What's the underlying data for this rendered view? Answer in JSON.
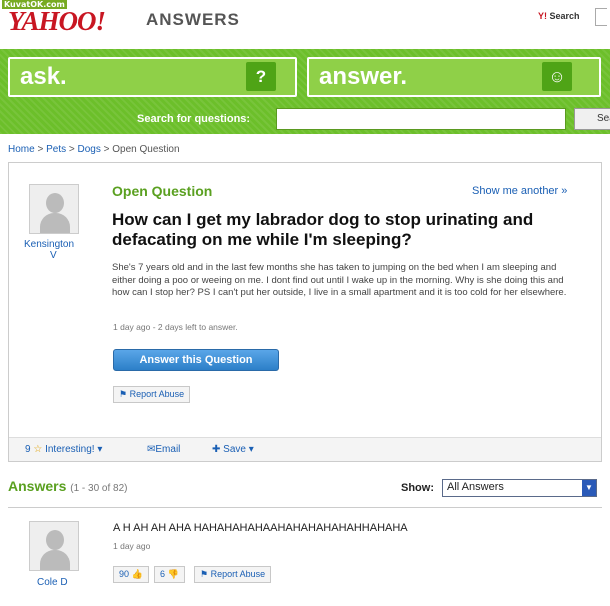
{
  "watermark": "KuvatOK.com",
  "brand": {
    "logo": "YAHOO!",
    "section": "ANSWERS"
  },
  "header": {
    "search_link": "Search"
  },
  "ask": {
    "label": "ask.",
    "icon_glyph": "?"
  },
  "answer": {
    "label": "answer.",
    "icon_glyph": "☺"
  },
  "search": {
    "label": "Search for questions:",
    "value": "",
    "button": "Search"
  },
  "breadcrumb": [
    "Home",
    "Pets",
    "Dogs",
    "Open Question"
  ],
  "question": {
    "status": "Open Question",
    "show_another": "Show me another »",
    "asker": "Kensington",
    "title": "How can I get my labrador dog to stop urinating and defacating on me while I'm sleeping?",
    "body": "She's 7 years old and in the last few months she has taken to jumping on the bed when I am sleeping and either doing a poo or weeing on me. I dont find out until I wake up in the morning. Why is she doing this and how can I stop her? PS I can't put her outside, I live in a small apartment and it is too cold for her elsewhere.",
    "meta": "1 day ago - 2 days left to answer.",
    "answer_button": "Answer this Question",
    "report_abuse": "Report Abuse"
  },
  "toolbar": {
    "interesting_count": "9",
    "interesting": "Interesting!",
    "email": "Email",
    "save": "Save"
  },
  "answers": {
    "heading": "Answers",
    "range": "(1 - 30 of 82)",
    "show_label": "Show:",
    "show_value": "All Answers"
  },
  "answer_item": {
    "user": "Cole D",
    "text": "A H AH AH AHA HAHAHAHAHAAHAHAHAHAHAHHAHAHA",
    "meta": "1 day ago",
    "thumbs_up": "90",
    "thumbs_down": "6",
    "report_abuse": "Report Abuse"
  },
  "colors": {
    "brand_red": "#c81622",
    "green": "#6cbf2a",
    "link_blue": "#1a5fb4"
  }
}
